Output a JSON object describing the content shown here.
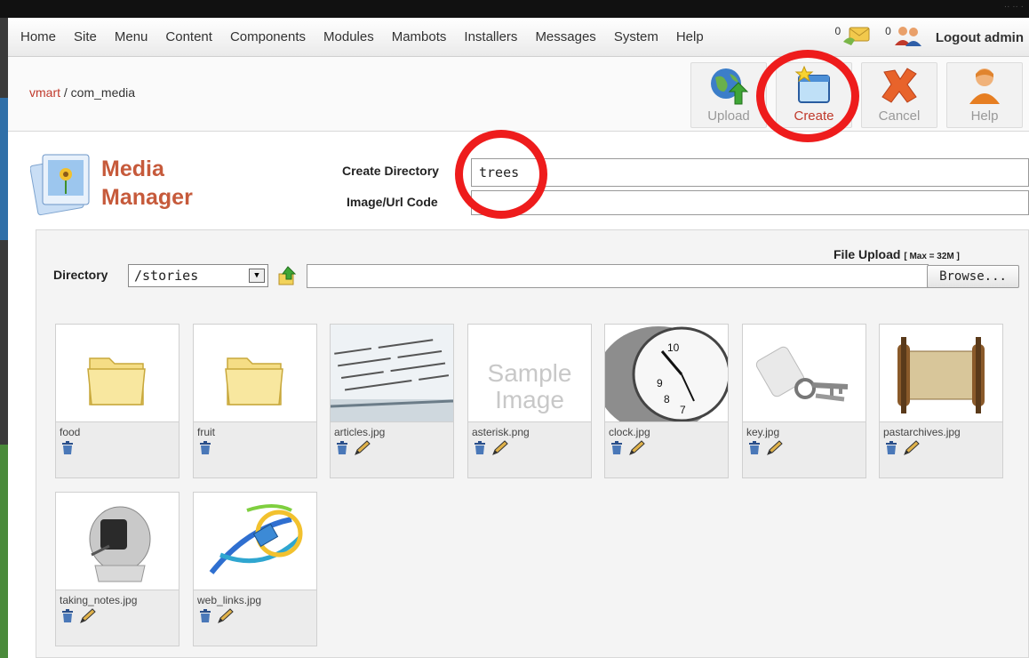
{
  "topbar": {
    "right_text": "·· ·· ·"
  },
  "menu": {
    "items": [
      "Home",
      "Site",
      "Menu",
      "Content",
      "Components",
      "Modules",
      "Mambots",
      "Installers",
      "Messages",
      "System",
      "Help"
    ],
    "messages_count": "0",
    "users_count": "0",
    "logout_label": "Logout admin"
  },
  "breadcrumb": {
    "link": "vmart",
    "separator": " / ",
    "current": "com_media"
  },
  "toolbar": {
    "upload_label": "Upload",
    "create_label": "Create",
    "cancel_label": "Cancel",
    "help_label": "Help"
  },
  "page_title": {
    "line1": "Media",
    "line2": "Manager"
  },
  "form": {
    "create_directory_label": "Create Directory",
    "create_directory_value": "trees",
    "image_url_label": "Image/Url Code",
    "image_url_value": ""
  },
  "upload": {
    "label": "File Upload",
    "max_text": "[ Max = 32M ]",
    "browse_label": "Browse...",
    "directory_label": "Directory",
    "directory_value": "/stories"
  },
  "files": [
    {
      "name": "food",
      "kind": "folder",
      "editable": false
    },
    {
      "name": "fruit",
      "kind": "folder",
      "editable": false
    },
    {
      "name": "articles.jpg",
      "kind": "image",
      "editable": true
    },
    {
      "name": "asterisk.png",
      "kind": "sample",
      "editable": true
    },
    {
      "name": "clock.jpg",
      "kind": "image",
      "editable": true
    },
    {
      "name": "key.jpg",
      "kind": "image",
      "editable": true
    },
    {
      "name": "pastarchives.jpg",
      "kind": "image",
      "editable": true
    },
    {
      "name": "taking_notes.jpg",
      "kind": "image",
      "editable": true
    },
    {
      "name": "web_links.jpg",
      "kind": "image",
      "editable": true
    }
  ],
  "sample_image": {
    "line1": "Sample",
    "line2": "Image"
  },
  "icons": {
    "trash": "trash-icon",
    "edit": "pencil-icon",
    "folder": "folder-icon"
  },
  "colors": {
    "accent_red": "#c65a3b",
    "highlight_circle": "#ee1c1c",
    "link": "#c0392b"
  }
}
